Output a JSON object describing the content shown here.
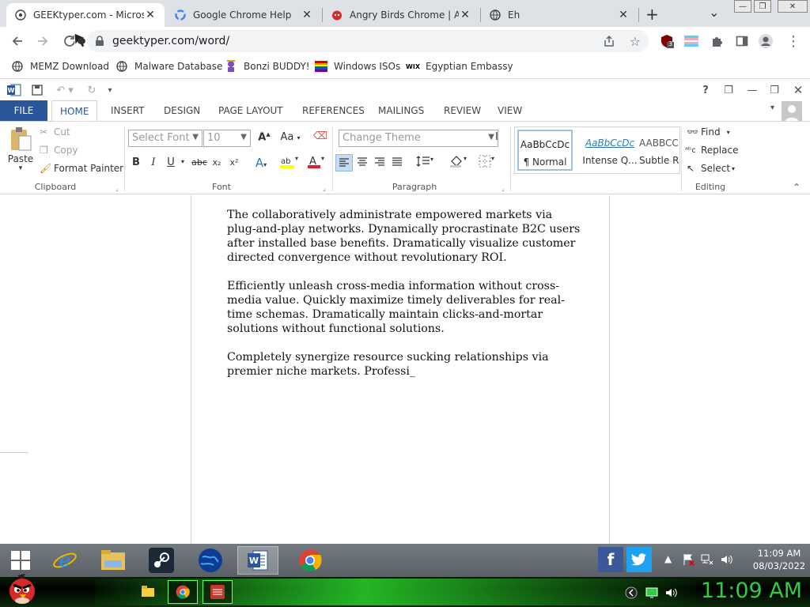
{
  "browser": {
    "tabs": [
      {
        "title": "GEEKtyper.com - Microso",
        "active": true
      },
      {
        "title": "Google Chrome Help",
        "active": false
      },
      {
        "title": "Angry Birds Chrome | Ang",
        "active": false
      },
      {
        "title": "Eh",
        "active": false
      }
    ],
    "new_tab": "+",
    "tab_menu": "⌄",
    "url": "geektyper.com/word/",
    "extension_badge": "3",
    "bookmarks": [
      {
        "label": "MEMZ Download",
        "icon": "globe-icon"
      },
      {
        "label": "Malware Database",
        "icon": "globe-icon"
      },
      {
        "label": "Bonzi BUDDY!",
        "icon": "bonzi-icon"
      },
      {
        "label": "Windows ISOs",
        "icon": "windows-flag-icon"
      },
      {
        "label": "Egyptian Embassy",
        "icon": "wix-icon"
      }
    ],
    "wix_label": "WIX"
  },
  "word": {
    "quick_access": {
      "help": "?",
      "restore": "❐",
      "minimize": "—",
      "maximize": "❐",
      "close": "✕"
    },
    "ribbon_tabs": [
      "FILE",
      "HOME",
      "INSERT",
      "DESIGN",
      "PAGE LAYOUT",
      "REFERENCES",
      "MAILINGS",
      "REVIEW",
      "VIEW"
    ],
    "clipboard": {
      "paste": "Paste",
      "cut": "Cut",
      "copy": "Copy",
      "format_painter": "Format Painter",
      "label": "Clipboard"
    },
    "font": {
      "font_select": "Select Font",
      "size_select": "10",
      "label": "Font",
      "case": "Aa",
      "bold": "B",
      "italic": "I",
      "underline": "U",
      "strike": "abc",
      "subscript": "x₂",
      "superscript": "x²"
    },
    "paragraph": {
      "theme_select": "Change Theme",
      "label": "Paragraph"
    },
    "styles": [
      {
        "sample": "AaBbCcDc",
        "name": "¶ Normal"
      },
      {
        "sample": "AaBbCcDc",
        "name": "Intense Q..."
      },
      {
        "sample": "AABBCC",
        "name": "Subtle Re"
      }
    ],
    "editing": {
      "find": "Find",
      "replace": "Replace",
      "select": "Select",
      "label": "Editing"
    }
  },
  "document": {
    "paragraphs": [
      "The collaboratively administrate empowered markets via plug-and-play networks. Dynamically procrastinate B2C users after installed base benefits. Dramatically visualize customer directed convergence without revolutionary ROI.",
      "Efficiently unleash cross-media information without cross-media value. Quickly maximize timely deliverables for real-time schemas. Dramatically maintain clicks-and-mortar solutions without functional solutions.",
      "Completely synergize resource sucking relationships via premier niche markets. Professi_"
    ]
  },
  "taskbar": {
    "time": "11:09 AM",
    "date": "08/03/2022",
    "facebook": "f",
    "dock_time": "11:09 AM"
  },
  "colors": {
    "word_blue": "#2b579a",
    "chrome_bg": "#dee1e6",
    "dock_green": "#2ecc40"
  }
}
